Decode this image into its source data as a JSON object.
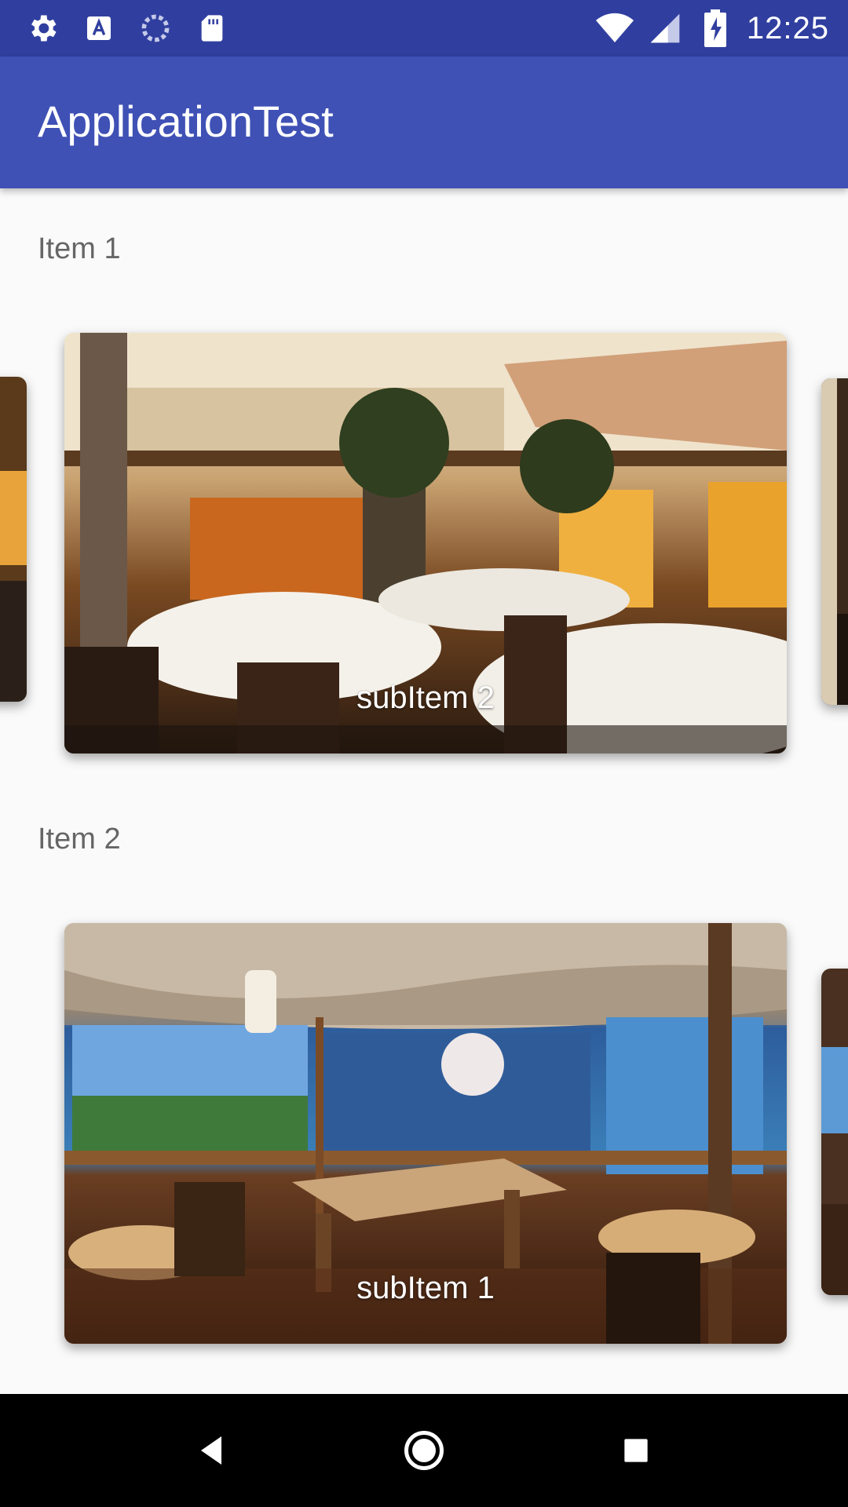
{
  "status_bar": {
    "time": "12:25",
    "left_icons": [
      "settings-icon",
      "text-a-icon",
      "sync-icon",
      "sd-card-icon"
    ],
    "right_icons": [
      "wifi-icon",
      "cell-signal-icon",
      "battery-charging-icon"
    ]
  },
  "app_bar": {
    "title": "ApplicationTest"
  },
  "sections": [
    {
      "title": "Item 1",
      "visible_card_caption": "subItem 2"
    },
    {
      "title": "Item 2",
      "visible_card_caption": "subItem 1"
    }
  ],
  "nav_bar": {
    "buttons": [
      "back-icon",
      "home-icon",
      "recents-icon"
    ]
  },
  "colors": {
    "status_bar": "#303f9f",
    "app_bar": "#3f51b5",
    "background": "#fafafa"
  }
}
